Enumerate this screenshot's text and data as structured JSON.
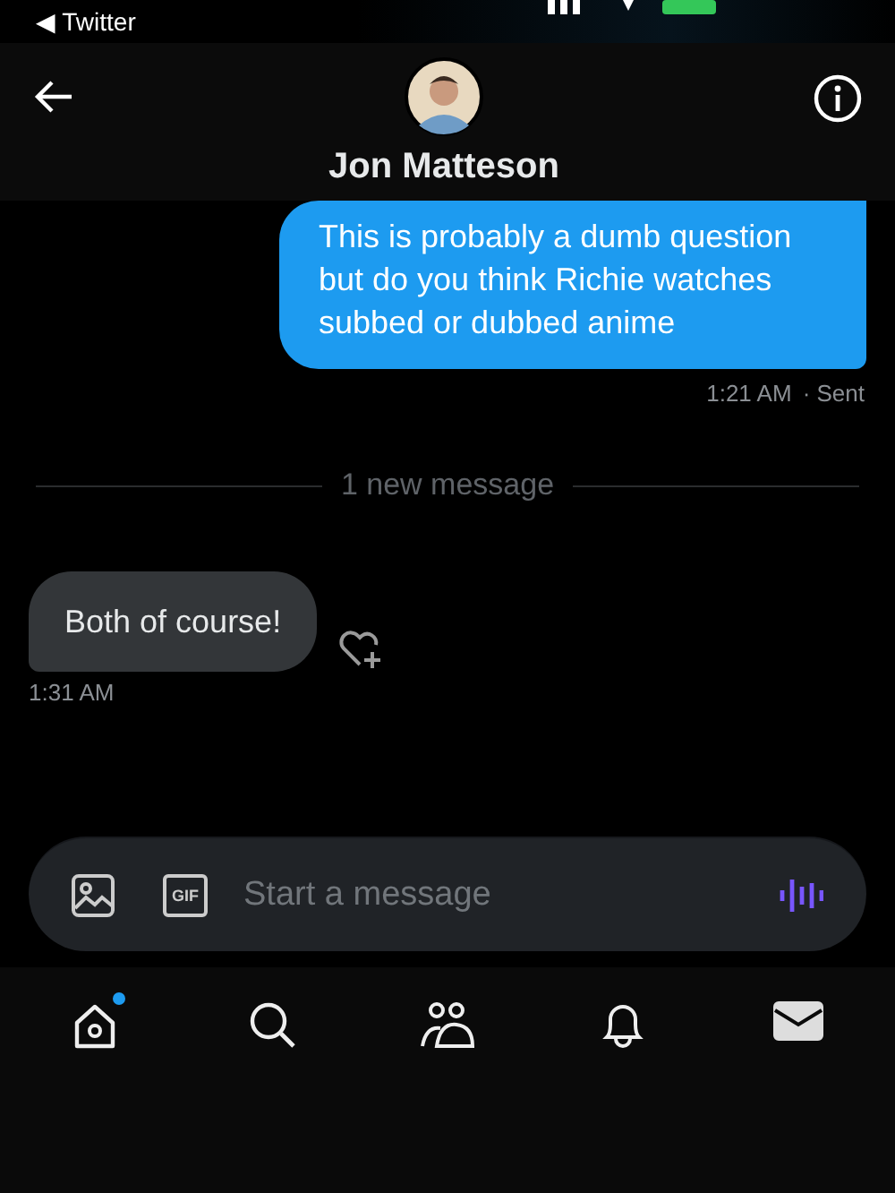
{
  "status_bar": {
    "back_app": "◀ Twitter"
  },
  "header": {
    "name": "Jon Matteson"
  },
  "messages": [
    {
      "kind": "sent",
      "text": "This is probably a dumb question but do you think Richie watches subbed or dubbed anime",
      "time": "1:21 AM",
      "status": "· Sent"
    },
    {
      "kind": "divider",
      "text": "1 new message"
    },
    {
      "kind": "received",
      "text": "Both of course!",
      "time": "1:31 AM"
    }
  ],
  "composer": {
    "gif_label": "GIF",
    "placeholder": "Start a message"
  },
  "nav": [
    {
      "kind": "home",
      "selected": false,
      "badge": true
    },
    {
      "kind": "search",
      "selected": false,
      "badge": false
    },
    {
      "kind": "communities",
      "selected": false,
      "badge": false
    },
    {
      "kind": "notifications",
      "selected": false,
      "badge": false
    },
    {
      "kind": "messages",
      "selected": true,
      "badge": false
    }
  ]
}
